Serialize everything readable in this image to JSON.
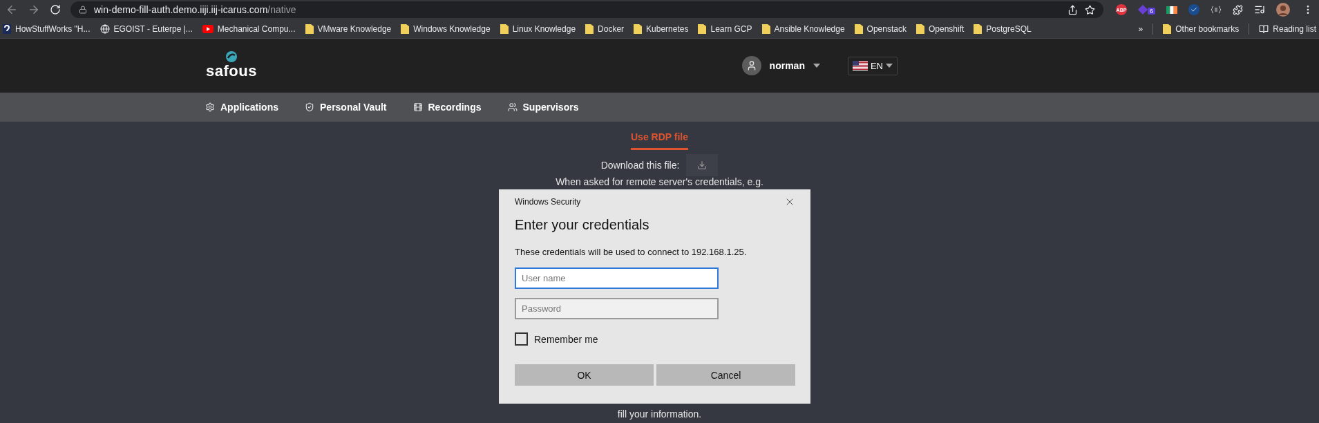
{
  "browser": {
    "url_host": "win-demo-fill-auth.demo.iiji.iij-icarus.com",
    "url_path": "/native",
    "extensions": [
      {
        "kind": "abp",
        "label": "ABP"
      },
      {
        "kind": "badge",
        "label": "6"
      },
      {
        "kind": "flag"
      },
      {
        "kind": "check"
      },
      {
        "kind": "braces"
      },
      {
        "kind": "puzzle"
      },
      {
        "kind": "playlist"
      },
      {
        "kind": "avatar"
      }
    ]
  },
  "bookmarks": [
    {
      "kind": "site",
      "label": "HowStuffWorks \"H..."
    },
    {
      "kind": "globe",
      "label": "EGOIST - Euterpe |..."
    },
    {
      "kind": "video",
      "label": "Mechanical Compu..."
    },
    {
      "kind": "folder",
      "label": "VMware Knowledge"
    },
    {
      "kind": "folder",
      "label": "Windows Knowledge"
    },
    {
      "kind": "folder",
      "label": "Linux Knowledge"
    },
    {
      "kind": "folder",
      "label": "Docker"
    },
    {
      "kind": "folder",
      "label": "Kubernetes"
    },
    {
      "kind": "folder",
      "label": "Learn GCP"
    },
    {
      "kind": "folder",
      "label": "Ansible Knowledge"
    },
    {
      "kind": "folder",
      "label": "Openstack"
    },
    {
      "kind": "folder",
      "label": "Openshift"
    },
    {
      "kind": "folder",
      "label": "PostgreSQL"
    }
  ],
  "bookmarks_overflow": "»",
  "other_bookmarks": "Other bookmarks",
  "reading_list": "Reading list",
  "header": {
    "logo": "safous",
    "user": "norman",
    "language": "EN"
  },
  "nav": [
    {
      "kind": "gear",
      "label": "Applications"
    },
    {
      "kind": "shield",
      "label": "Personal Vault"
    },
    {
      "kind": "film",
      "label": "Recordings"
    },
    {
      "kind": "people",
      "label": "Supervisors"
    }
  ],
  "tabs": [
    {
      "label": "Use RDP file",
      "selected": true
    }
  ],
  "download_label": "Download this file:",
  "instructions": [
    "When asked for remote server's credentials, e.g.",
    "fill your information."
  ],
  "dialog": {
    "title": "Windows Security",
    "heading": "Enter your credentials",
    "message": "These credentials will be used to connect to 192.168.1.25.",
    "fields": [
      {
        "placeholder": "User name",
        "focused": true
      },
      {
        "placeholder": "Password",
        "focused": false
      }
    ],
    "remember": {
      "label": "Remember me",
      "checked": false
    },
    "buttons": [
      "OK",
      "Cancel"
    ]
  }
}
